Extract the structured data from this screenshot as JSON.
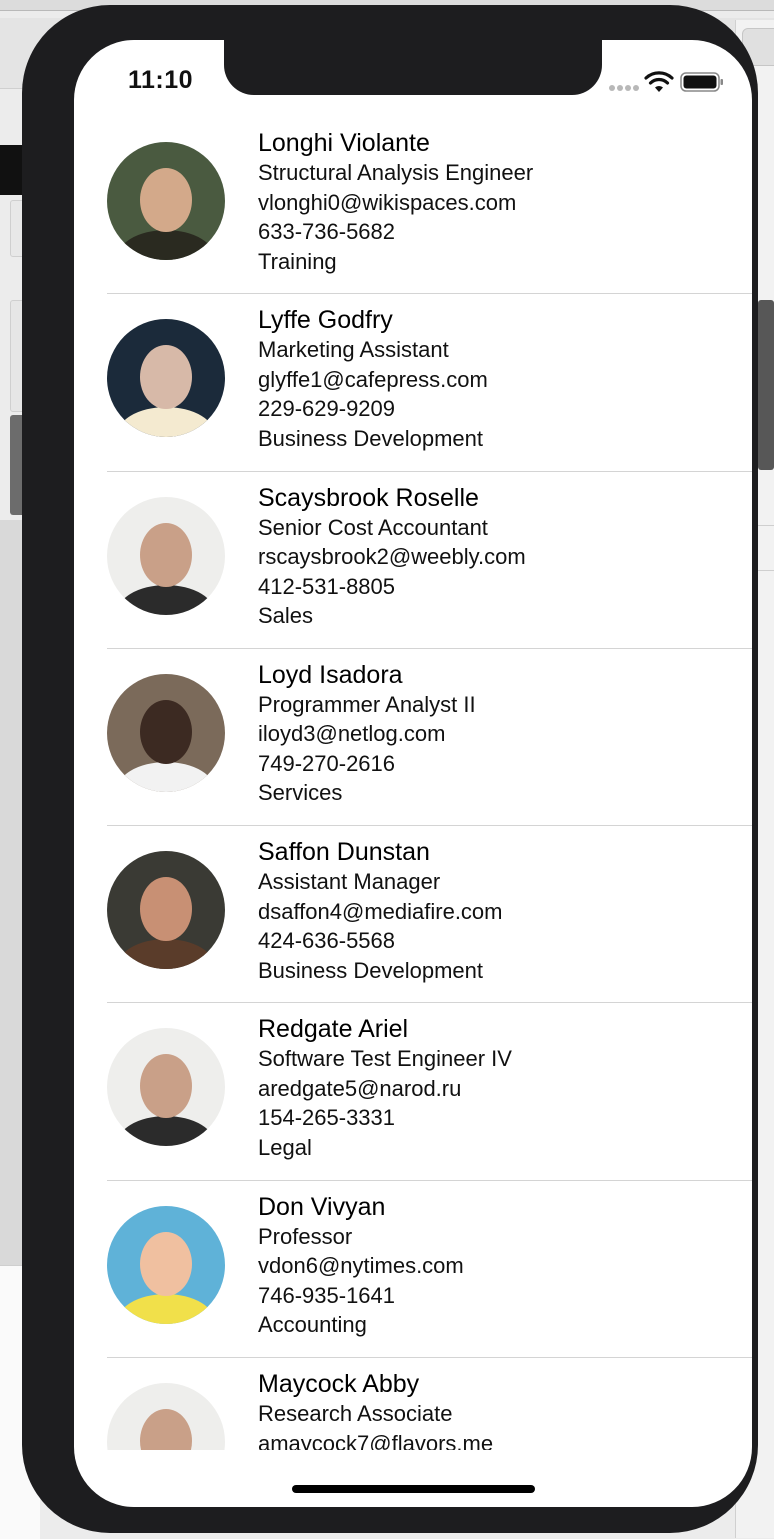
{
  "status_bar": {
    "time": "11:10",
    "icons": [
      "signal-icon",
      "wifi-icon",
      "battery-icon"
    ]
  },
  "contacts": [
    {
      "name": "Longhi Violante",
      "title": "Structural Analysis Engineer",
      "email": "vlonghi0@wikispaces.com",
      "phone": "633-736-5682",
      "department": "Training",
      "avatar_colors": [
        "#4a5a40",
        "#d3a98a",
        "#2a2a20"
      ]
    },
    {
      "name": "Lyffe Godfry",
      "title": "Marketing Assistant",
      "email": "glyffe1@cafepress.com",
      "phone": "229-629-9209",
      "department": "Business Development",
      "avatar_colors": [
        "#1b2a3a",
        "#d7b9a8",
        "#f4ead0"
      ]
    },
    {
      "name": "Scaysbrook Roselle",
      "title": "Senior Cost Accountant",
      "email": "rscaysbrook2@weebly.com",
      "phone": "412-531-8805",
      "department": "Sales",
      "avatar_colors": [
        "#eeeeec",
        "#c9a088",
        "#2b2b2b"
      ]
    },
    {
      "name": "Loyd Isadora",
      "title": "Programmer Analyst II",
      "email": "iloyd3@netlog.com",
      "phone": "749-270-2616",
      "department": "Services",
      "avatar_colors": [
        "#7b6a5a",
        "#3c2a22",
        "#f2f2f2"
      ]
    },
    {
      "name": "Saffon Dunstan",
      "title": "Assistant Manager",
      "email": "dsaffon4@mediafire.com",
      "phone": "424-636-5568",
      "department": "Business Development",
      "avatar_colors": [
        "#3a3a34",
        "#c89074",
        "#5a3c2a"
      ]
    },
    {
      "name": "Redgate Ariel",
      "title": "Software Test Engineer IV",
      "email": "aredgate5@narod.ru",
      "phone": "154-265-3331",
      "department": "Legal",
      "avatar_colors": [
        "#eeeeec",
        "#c9a088",
        "#2b2b2b"
      ]
    },
    {
      "name": "Don Vivyan",
      "title": "Professor",
      "email": "vdon6@nytimes.com",
      "phone": "746-935-1641",
      "department": "Accounting",
      "avatar_colors": [
        "#5fb2d8",
        "#f0c0a0",
        "#f1e04a"
      ]
    },
    {
      "name": "Maycock Abby",
      "title": "Research Associate",
      "email": "amaycock7@flavors.me",
      "phone": "",
      "department": "",
      "avatar_colors": [
        "#eeeeec",
        "#c9a088",
        "#2b2b2b"
      ]
    }
  ]
}
